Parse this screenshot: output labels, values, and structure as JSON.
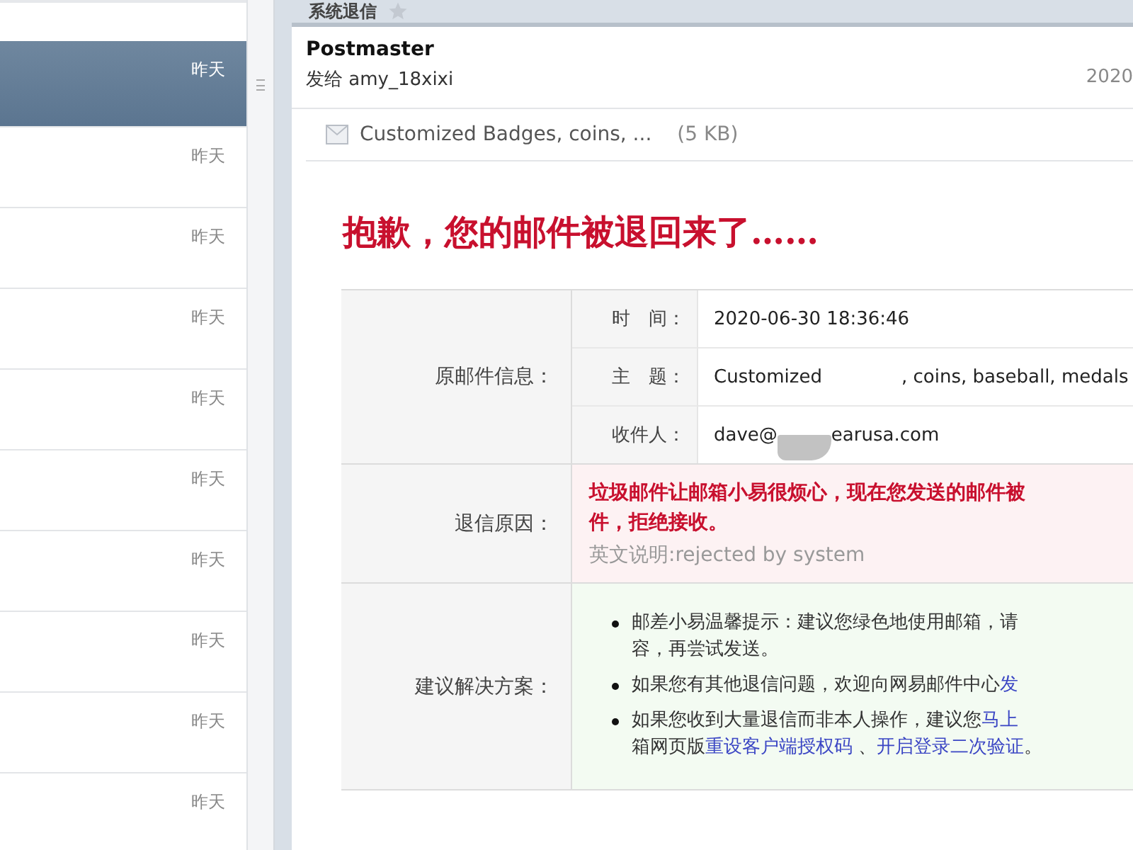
{
  "mail_list": {
    "items": [
      {
        "date": "昨天",
        "selected": true
      },
      {
        "date": "昨天",
        "selected": false
      },
      {
        "date": "昨天",
        "selected": false
      },
      {
        "date": "昨天",
        "selected": false
      },
      {
        "date": "昨天",
        "selected": false
      },
      {
        "date": "昨天",
        "selected": false
      },
      {
        "date": "昨天",
        "selected": false
      },
      {
        "date": "昨天",
        "selected": false
      },
      {
        "date": "昨天",
        "selected": false
      },
      {
        "date": "昨天",
        "selected": false
      }
    ]
  },
  "tab": {
    "title": "系统退信"
  },
  "message": {
    "sender": "Postmaster",
    "recipient": "发给 amy_18xixi",
    "date": "2020",
    "attachment": {
      "name": "Customized Badges, coins, ...",
      "size": "(5 KB)"
    },
    "heading": "抱歉，您的邮件被退回来了……",
    "info": {
      "label": "原邮件信息：",
      "fields": [
        {
          "label": "时　间：",
          "parts": [
            "2020-06-30 18:36:46"
          ]
        },
        {
          "label": "主　题：",
          "parts": [
            "Customized",
            ", coins, baseball, medals"
          ]
        },
        {
          "label": "收件人：",
          "parts": [
            "dave@",
            "earusa.com"
          ]
        }
      ]
    },
    "reason": {
      "label": "退信原因：",
      "lines": [
        "垃圾邮件让邮箱小易很烦心，现在您发送的邮件被",
        "件，拒绝接收。"
      ],
      "note": "英文说明:rejected by system"
    },
    "solutions": {
      "label": "建议解决方案：",
      "bullets": [
        [
          {
            "kind": "text",
            "text": "邮差小易温馨提示：建议您绿色地使用邮箱，请"
          },
          {
            "kind": "break"
          },
          {
            "kind": "text",
            "text": "容，再尝试发送。"
          }
        ],
        [
          {
            "kind": "text",
            "text": "如果您有其他退信问题，欢迎向网易邮件中心"
          },
          {
            "kind": "link",
            "text": "发"
          }
        ],
        [
          {
            "kind": "text",
            "text": "如果您收到大量退信而非本人操作，建议您"
          },
          {
            "kind": "link",
            "text": "马上"
          },
          {
            "kind": "break"
          },
          {
            "kind": "text",
            "text": "箱网页版"
          },
          {
            "kind": "link",
            "text": "重设客户端授权码"
          },
          {
            "kind": "text",
            "text": " 、"
          },
          {
            "kind": "link",
            "text": "开启登录二次验证"
          },
          {
            "kind": "text",
            "text": "。"
          }
        ]
      ]
    }
  }
}
